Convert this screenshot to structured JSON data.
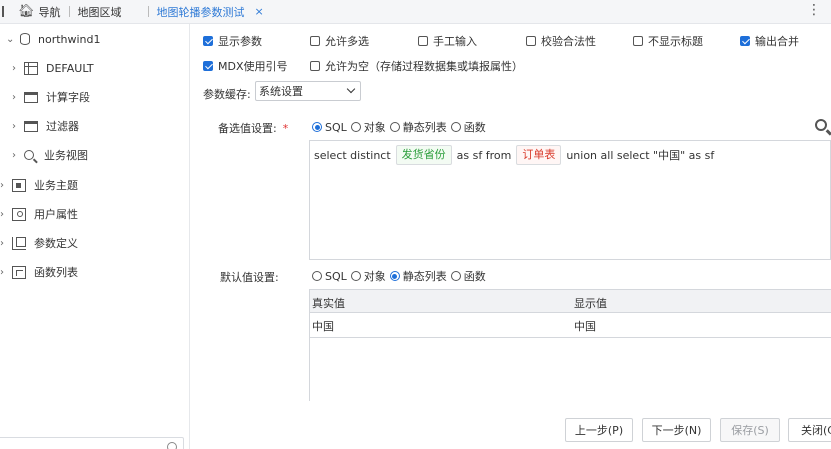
{
  "topbar": {
    "nav_label": "导航",
    "tab_map_area": "地图区域",
    "tab_active": "地图轮播参数测试",
    "close": "×",
    "kebab": "⋮"
  },
  "sidebar": {
    "items": [
      {
        "chev": "⌄",
        "label": "northwind1"
      },
      {
        "chev": "›",
        "label": "DEFAULT"
      },
      {
        "chev": "›",
        "label": "计算字段"
      },
      {
        "chev": "›",
        "label": "过滤器"
      },
      {
        "chev": "›",
        "label": "业务视图"
      },
      {
        "chev": "›",
        "label": "业务主题"
      },
      {
        "chev": "›",
        "label": "用户属性"
      },
      {
        "chev": "›",
        "label": "参数定义"
      },
      {
        "chev": "›",
        "label": "函数列表"
      }
    ],
    "search_placeholder": ""
  },
  "options": {
    "show_param": {
      "label": "显示参数",
      "checked": true
    },
    "allow_multi": {
      "label": "允许多选",
      "checked": false
    },
    "manual_input": {
      "label": "手工输入",
      "checked": false
    },
    "validate": {
      "label": "校验合法性",
      "checked": false
    },
    "hide_title": {
      "label": "不显示标题",
      "checked": false
    },
    "output_merge": {
      "label": "输出合并",
      "checked": true
    },
    "mdx_quote": {
      "label": "MDX使用引号",
      "checked": true
    },
    "allow_empty": {
      "label": "允许为空（存储过程数据集或填报属性）",
      "checked": false
    }
  },
  "cache": {
    "label": "参数缓存:",
    "value": "系统设置"
  },
  "candidate": {
    "label": "备选值设置:",
    "required": "*",
    "radios": [
      "SQL",
      "对象",
      "静态列表",
      "函数"
    ],
    "selected": "SQL"
  },
  "sql": {
    "part1": "select distinct",
    "chip1": "发货省份",
    "part2": "as sf from",
    "chip2": "订单表",
    "part3": "union all select \"中国\" as sf"
  },
  "default_value": {
    "label": "默认值设置:",
    "radios": [
      "SQL",
      "对象",
      "静态列表",
      "函数"
    ],
    "selected": "静态列表"
  },
  "grid": {
    "columns": [
      "真实值",
      "显示值"
    ],
    "rows": [
      [
        "中国",
        "中国"
      ]
    ]
  },
  "buttons": {
    "prev": "上一步(P)",
    "next": "下一步(N)",
    "save": "保存(S)",
    "close": "关闭(C)"
  }
}
